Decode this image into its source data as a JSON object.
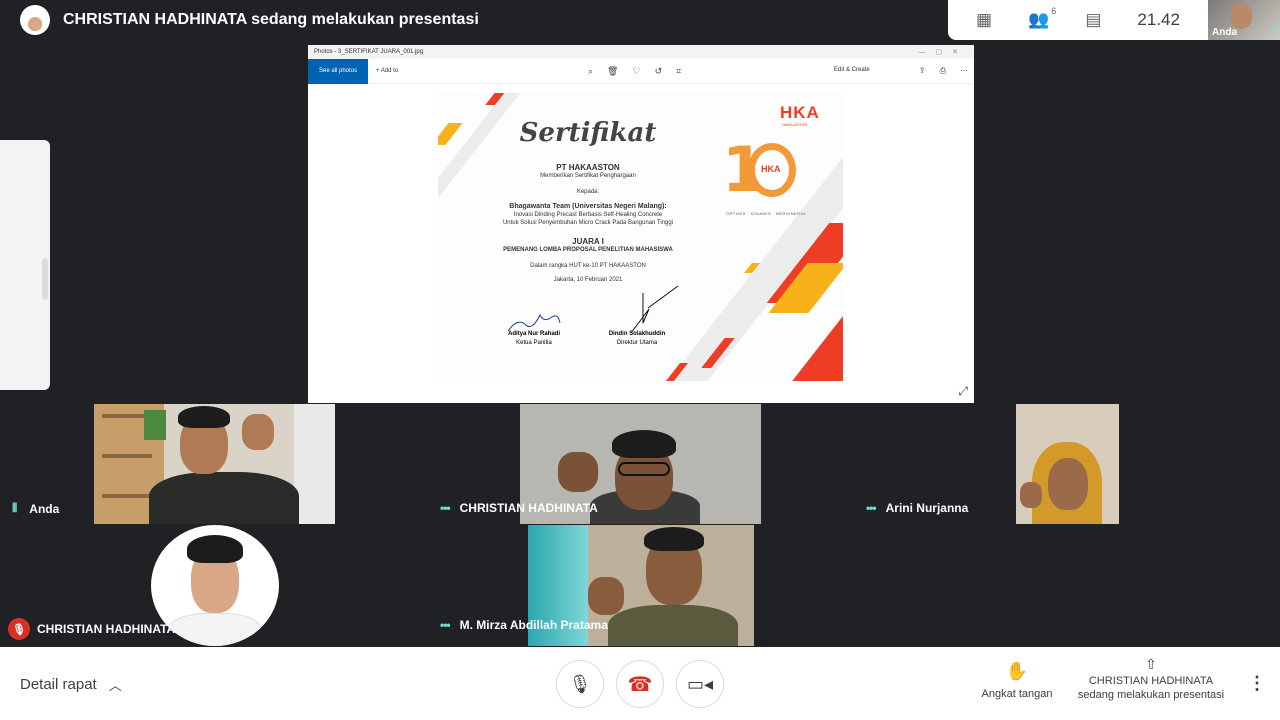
{
  "presenter_banner": {
    "title": "CHRISTIAN HADHINATA sedang melakukan presentasi"
  },
  "top_controls": {
    "participants_count": "6",
    "clock": "21.42",
    "self_label": "Anda"
  },
  "shared_window": {
    "filename": "Photos - 3_SERTIFIKAT JUARA_001.jpg",
    "see_all": "See all photos",
    "add_to": "+ Add to",
    "edit_create": "Edit & Create",
    "certificate": {
      "heading": "Sertifikat",
      "company": "PT HAKAASTON",
      "intro": "Memberikan Sertifikat Penghargaan",
      "kepada": "Kepada:",
      "team": "Bhagawanta Team (Universitas Negeri Malang):",
      "project_line1": "Inovasi Dinding Precast Berbasis Self-Healing Concrete",
      "project_line2": "Untuk Solusi Penyembuhan Micro Crack Pada Bangunan Tinggi",
      "award": "JUARA I",
      "competition": "PEMENANG LOMBA PROPOSAL PENELITIAN MAHASISWA",
      "occasion": "Dalam rangka HUT ke-10 PT HAKAASTON",
      "place_date": "Jakarta, 10 Februari 2021",
      "sign1_name": "Aditya Nur Rahadi",
      "sign1_role": "Ketua Panitia",
      "sign2_name": "Dindin Solakhuddin",
      "sign2_role": "Direktur Utama",
      "logo": "HKA",
      "logo_sub": "HAKA ASTON",
      "tagline": "OPTIMIS · DINAMIS · BERSINERGI"
    }
  },
  "participants": [
    {
      "name": "Anda",
      "status": "speaking"
    },
    {
      "name": "CHRISTIAN HADHINATA",
      "status": "active"
    },
    {
      "name": "Arini Nurjanna",
      "status": "active"
    },
    {
      "name": "CHRISTIAN HADHINATA",
      "status": "muted"
    },
    {
      "name": "M. Mirza Abdillah Pratama",
      "status": "active"
    }
  ],
  "bottom_bar": {
    "meeting_details": "Detail rapat",
    "raise_hand": "Angkat tangan",
    "presenting_line1": "CHRISTIAN HADHINATA",
    "presenting_line2": "sedang melakukan presentasi"
  },
  "icons": [
    "grid-icon",
    "people-icon",
    "chat-icon",
    "mic-icon",
    "hangup-icon",
    "camera-icon",
    "hand-icon",
    "present-icon",
    "more-icon"
  ],
  "colors": {
    "background": "#202124",
    "accent_teal": "#6fe1d4",
    "hangup_red": "#d93025",
    "photos_blue": "#0063b1",
    "cert_red": "#ef3c24",
    "cert_yellow": "#f7b21b"
  }
}
